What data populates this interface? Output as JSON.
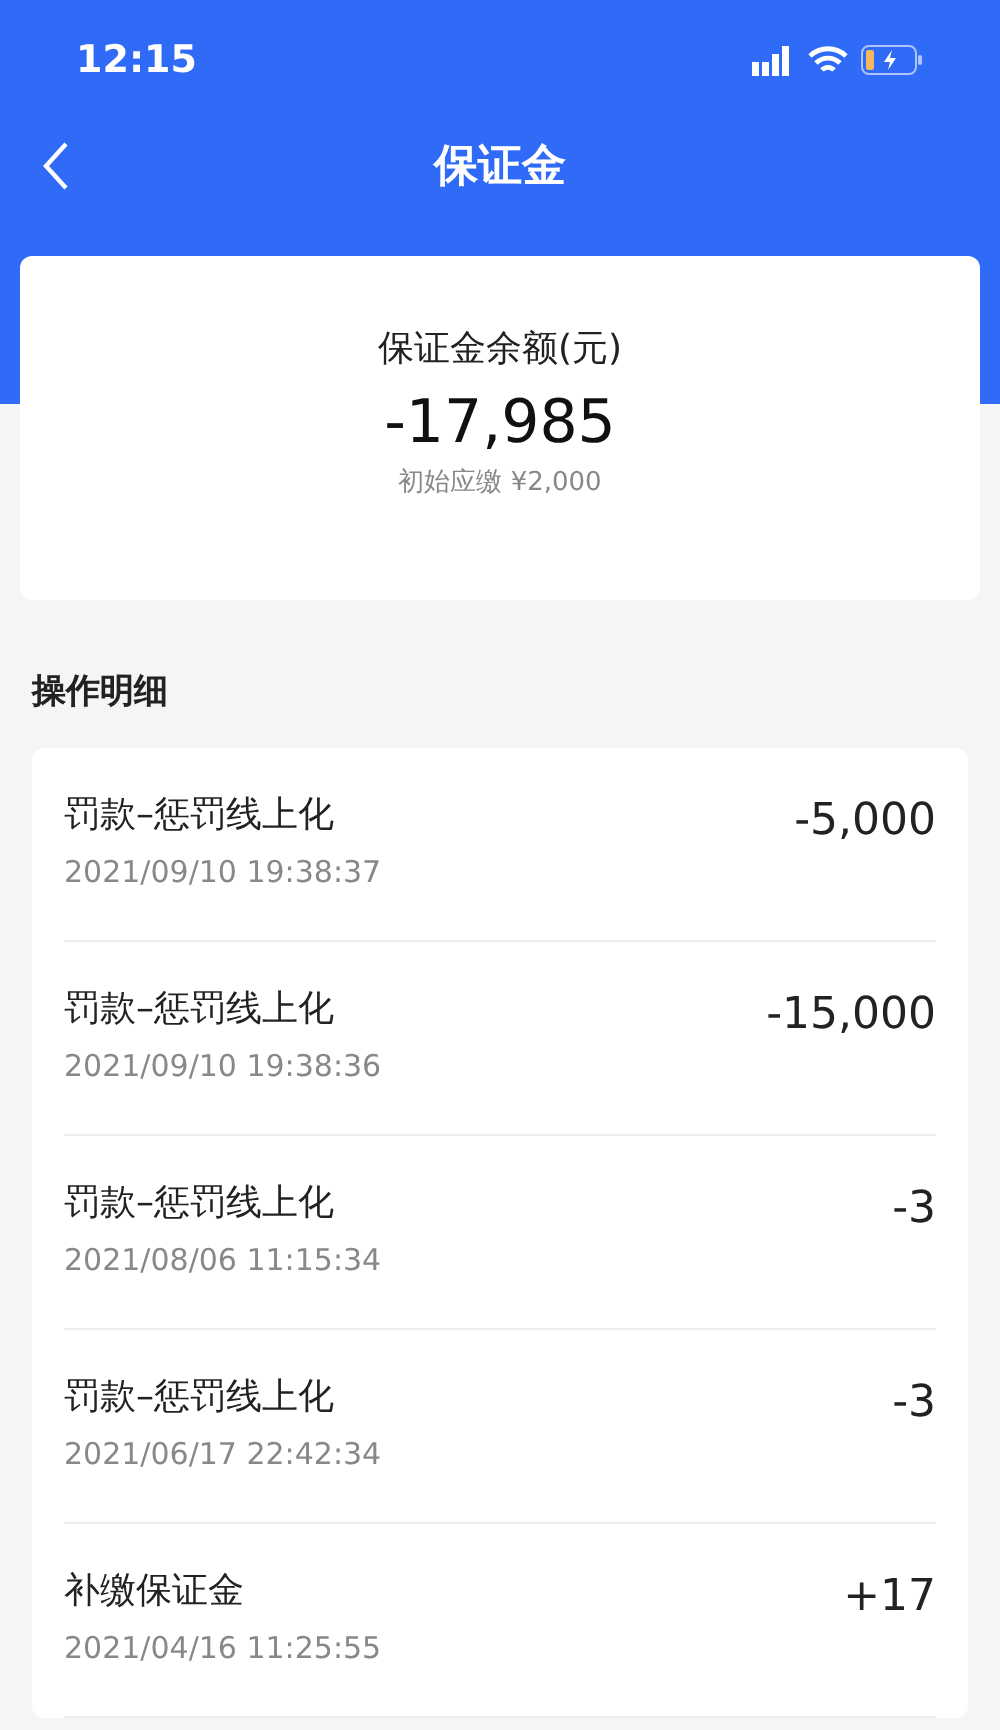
{
  "status_bar": {
    "time": "12:15"
  },
  "header": {
    "title": "保证金"
  },
  "summary": {
    "label": "保证金余额(元)",
    "amount": "-17,985",
    "note": "初始应缴 ¥2,000"
  },
  "section": {
    "title": "操作明细"
  },
  "records": [
    {
      "title": "罚款–惩罚线上化",
      "time": "2021/09/10 19:38:37",
      "amount": "-5,000"
    },
    {
      "title": "罚款–惩罚线上化",
      "time": "2021/09/10 19:38:36",
      "amount": "-15,000"
    },
    {
      "title": "罚款–惩罚线上化",
      "time": "2021/08/06 11:15:34",
      "amount": "-3"
    },
    {
      "title": "罚款–惩罚线上化",
      "time": "2021/06/17 22:42:34",
      "amount": "-3"
    },
    {
      "title": "补缴保证金",
      "time": "2021/04/16 11:25:55",
      "amount": "+17"
    }
  ]
}
